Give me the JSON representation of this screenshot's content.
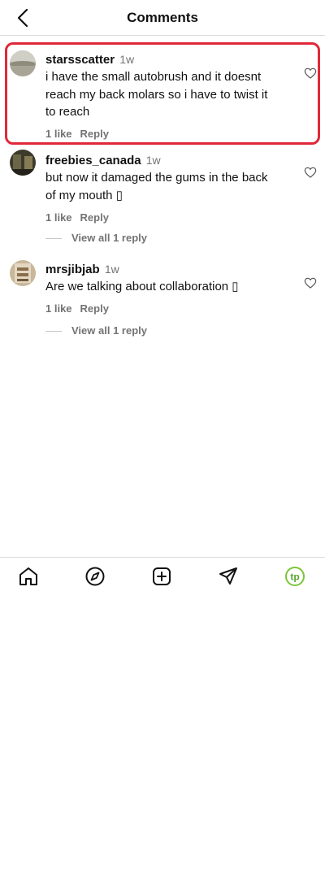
{
  "header": {
    "title": "Comments",
    "back_icon": "chevron-left-icon"
  },
  "comments": [
    {
      "username": "starsscatter",
      "time": "1w",
      "text": "i have the small autobrush and it doesnt reach my back molars so i have to twist it to reach",
      "likes": "1 like",
      "reply": "Reply",
      "highlighted": true
    },
    {
      "username": "freebies_canada",
      "time": "1w",
      "text": "but now it damaged the gums in the back of my mouth ▯",
      "likes": "1 like",
      "reply": "Reply",
      "view_replies": "View all 1 reply"
    },
    {
      "username": "mrsjibjab",
      "time": "1w",
      "text": "Are we talking about collaboration ▯",
      "likes": "1 like",
      "reply": "Reply",
      "view_replies": "View all 1 reply"
    }
  ],
  "tabbar": {
    "items": [
      "home-icon",
      "explore-compass-icon",
      "create-plus-icon",
      "send-paper-plane-icon",
      "profile-avatar-icon"
    ],
    "profile_initials": "tp",
    "profile_color": "#7cc53a"
  },
  "colors": {
    "highlight_border": "#e0283a",
    "secondary_text": "#737373",
    "divider": "#dbdbdb"
  }
}
